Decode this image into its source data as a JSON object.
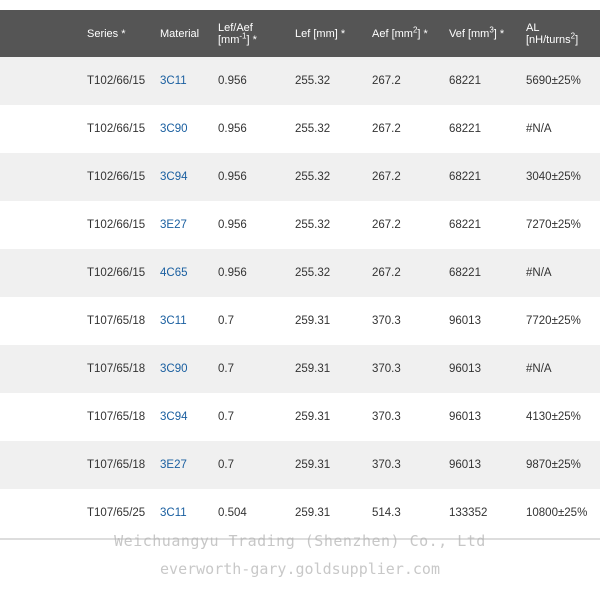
{
  "table": {
    "headers": {
      "series": "Series *",
      "material": "Material",
      "lef_aef_line1": "Lef/Aef",
      "lef_aef_unit_pre": "[mm",
      "lef_aef_unit_sup": "-1",
      "lef_aef_unit_post": "] *",
      "lef": "Lef [mm] *",
      "aef_pre": "Aef [mm",
      "aef_sup": "2",
      "aef_post": "] *",
      "vef_pre": "Vef [mm",
      "vef_sup": "3",
      "vef_post": "] *",
      "al_line1": "AL",
      "al_unit_pre": "[nH/turns",
      "al_unit_sup": "2",
      "al_unit_post": "]"
    },
    "rows": [
      {
        "series": "T102/66/15",
        "material": "3C11",
        "lef_aef": "0.956",
        "lef": "255.32",
        "aef": "267.2",
        "vef": "68221",
        "al": "5690±25%"
      },
      {
        "series": "T102/66/15",
        "material": "3C90",
        "lef_aef": "0.956",
        "lef": "255.32",
        "aef": "267.2",
        "vef": "68221",
        "al": "#N/A"
      },
      {
        "series": "T102/66/15",
        "material": "3C94",
        "lef_aef": "0.956",
        "lef": "255.32",
        "aef": "267.2",
        "vef": "68221",
        "al": "3040±25%"
      },
      {
        "series": "T102/66/15",
        "material": "3E27",
        "lef_aef": "0.956",
        "lef": "255.32",
        "aef": "267.2",
        "vef": "68221",
        "al": "7270±25%"
      },
      {
        "series": "T102/66/15",
        "material": "4C65",
        "lef_aef": "0.956",
        "lef": "255.32",
        "aef": "267.2",
        "vef": "68221",
        "al": "#N/A"
      },
      {
        "series": "T107/65/18",
        "material": "3C11",
        "lef_aef": "0.7",
        "lef": "259.31",
        "aef": "370.3",
        "vef": "96013",
        "al": "7720±25%"
      },
      {
        "series": "T107/65/18",
        "material": "3C90",
        "lef_aef": "0.7",
        "lef": "259.31",
        "aef": "370.3",
        "vef": "96013",
        "al": "#N/A"
      },
      {
        "series": "T107/65/18",
        "material": "3C94",
        "lef_aef": "0.7",
        "lef": "259.31",
        "aef": "370.3",
        "vef": "96013",
        "al": "4130±25%"
      },
      {
        "series": "T107/65/18",
        "material": "3E27",
        "lef_aef": "0.7",
        "lef": "259.31",
        "aef": "370.3",
        "vef": "96013",
        "al": "9870±25%"
      },
      {
        "series": "T107/65/25",
        "material": "3C11",
        "lef_aef": "0.504",
        "lef": "259.31",
        "aef": "514.3",
        "vef": "133352",
        "al": "10800±25%"
      }
    ]
  },
  "watermark": {
    "company": "Weichuangyu Trading (Shenzhen) Co., Ltd",
    "site": "everworth-gary.goldsupplier.com"
  },
  "colors": {
    "header_bg": "#555555",
    "row_alt_bg": "#f0f0f0",
    "link": "#1a5fa0"
  }
}
